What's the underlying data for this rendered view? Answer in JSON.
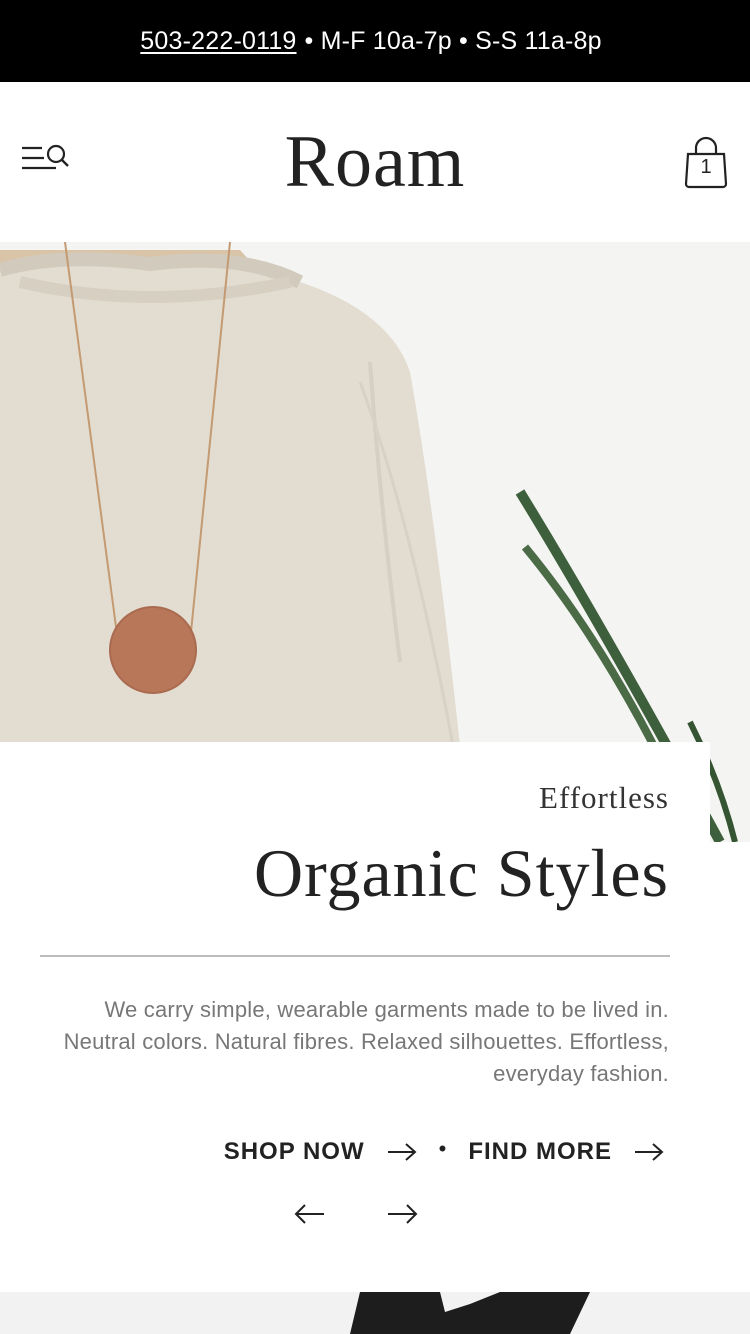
{
  "topbar": {
    "phone": "503-222-0119",
    "hours": "• M-F 10a-7p • S-S 11a-8p"
  },
  "header": {
    "logo": "Roam",
    "cart_count": "1",
    "menu_icon": "menu-search-icon",
    "cart_icon": "shopping-bag-icon"
  },
  "hero": {
    "image_icon": "sweater-pendant-photo",
    "eyebrow": "Effortless",
    "title": "Organic Styles",
    "description": "We carry simple, wearable garments made to be lived in. Neutral colors. Natural fibres. Relaxed silhouettes. Effortless, everyday fashion.",
    "shop_now_label": "SHOP NOW",
    "find_more_label": "FIND MORE",
    "separator": "•"
  },
  "colors": {
    "topbar_bg": "#000000",
    "text": "#222222",
    "muted_text": "#777777"
  }
}
